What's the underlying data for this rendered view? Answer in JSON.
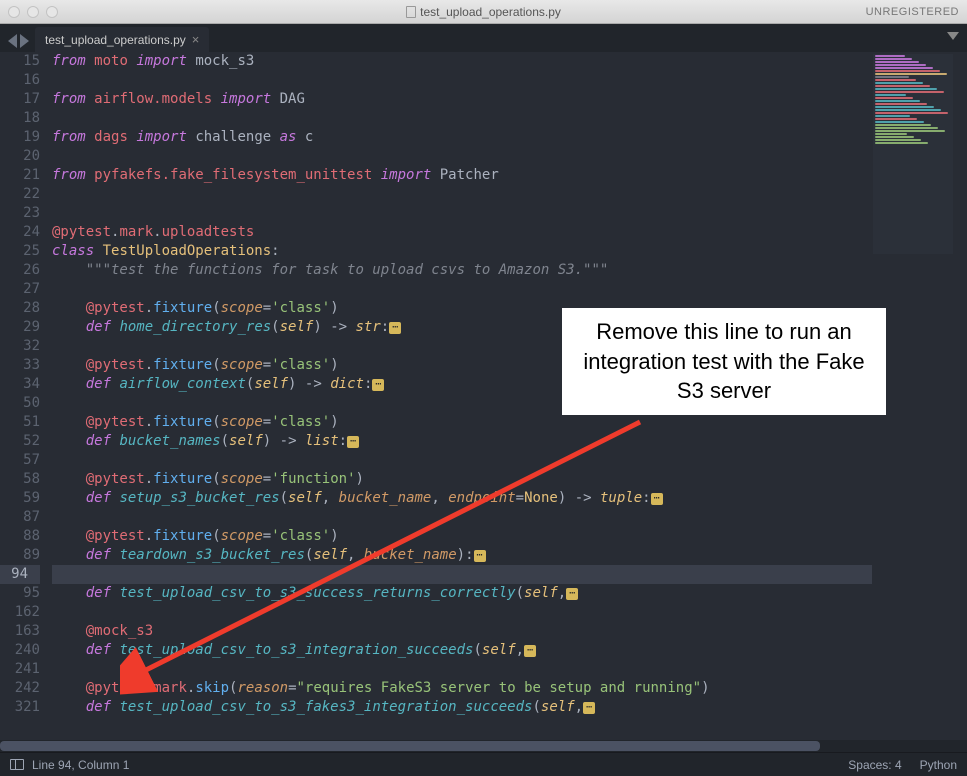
{
  "titlebar": {
    "filename": "test_upload_operations.py",
    "registration": "UNREGISTERED"
  },
  "tab": {
    "name": "test_upload_operations.py",
    "close": "×"
  },
  "annotation": "Remove this line to run an integration test with the Fake S3 server",
  "statusbar": {
    "position": "Line 94, Column 1",
    "spaces": "Spaces: 4",
    "syntax": "Python"
  },
  "gutter_lines": [
    "15",
    "16",
    "17",
    "18",
    "19",
    "20",
    "21",
    "22",
    "23",
    "24",
    "25",
    "26",
    "27",
    "28",
    "29",
    "32",
    "33",
    "34",
    "50",
    "51",
    "52",
    "57",
    "58",
    "59",
    "87",
    "88",
    "89",
    "94",
    "95",
    "162",
    "163",
    "240",
    "241",
    "242",
    "321"
  ],
  "code_lines": [
    {
      "html": "<span class='kw'>from</span> <span class='pink'>moto</span> <span class='kw'>import</span> mock_s3"
    },
    {
      "html": ""
    },
    {
      "html": "<span class='kw'>from</span> <span class='pink'>airflow.models</span> <span class='kw'>import</span> DAG"
    },
    {
      "html": ""
    },
    {
      "html": "<span class='kw'>from</span> <span class='pink'>dags</span> <span class='kw'>import</span> challenge <span class='kw'>as</span> c"
    },
    {
      "html": ""
    },
    {
      "html": "<span class='kw'>from</span> <span class='pink'>pyfakefs.fake_filesystem_unittest</span> <span class='kw'>import</span> Patcher"
    },
    {
      "html": ""
    },
    {
      "html": ""
    },
    {
      "html": "<span class='pink'>@pytest</span><span class='pn'>.</span><span class='pink'>mark</span><span class='pn'>.</span><span class='pink'>uploadtests</span>"
    },
    {
      "html": "<span class='kw2'>class</span> <span class='cls'>TestUploadOperations</span><span class='pn'>:</span>"
    },
    {
      "html": "    <span class='cm'>\"\"\"test the functions for task to upload csvs to Amazon S3.\"\"\"</span>"
    },
    {
      "html": ""
    },
    {
      "html": "    <span class='pink'>@pytest</span><span class='pn'>.</span><span class='fn'>fixture</span><span class='pn'>(</span><span class='arg'>scope</span><span class='op'>=</span><span class='str'>'class'</span><span class='pn'>)</span>"
    },
    {
      "html": "    <span class='kw2'>def</span> <span class='fnname'>home_directory_res</span><span class='pn'>(</span><span class='slf'>self</span><span class='pn'>)</span> <span class='op'>-&gt;</span> <span class='tp'>str</span><span class='pn'>:</span><span class='fold'>⋯</span>"
    },
    {
      "html": ""
    },
    {
      "html": "    <span class='pink'>@pytest</span><span class='pn'>.</span><span class='fn'>fixture</span><span class='pn'>(</span><span class='arg'>scope</span><span class='op'>=</span><span class='str'>'class'</span><span class='pn'>)</span>"
    },
    {
      "html": "    <span class='kw2'>def</span> <span class='fnname'>airflow_context</span><span class='pn'>(</span><span class='slf'>self</span><span class='pn'>)</span> <span class='op'>-&gt;</span> <span class='tp'>dict</span><span class='pn'>:</span><span class='fold'>⋯</span>"
    },
    {
      "html": ""
    },
    {
      "html": "    <span class='pink'>@pytest</span><span class='pn'>.</span><span class='fn'>fixture</span><span class='pn'>(</span><span class='arg'>scope</span><span class='op'>=</span><span class='str'>'class'</span><span class='pn'>)</span>"
    },
    {
      "html": "    <span class='kw2'>def</span> <span class='fnname'>bucket_names</span><span class='pn'>(</span><span class='slf'>self</span><span class='pn'>)</span> <span class='op'>-&gt;</span> <span class='tp'>list</span><span class='pn'>:</span><span class='fold'>⋯</span>"
    },
    {
      "html": ""
    },
    {
      "html": "    <span class='pink'>@pytest</span><span class='pn'>.</span><span class='fn'>fixture</span><span class='pn'>(</span><span class='arg'>scope</span><span class='op'>=</span><span class='str'>'function'</span><span class='pn'>)</span>"
    },
    {
      "html": "    <span class='kw2'>def</span> <span class='fnname'>setup_s3_bucket_res</span><span class='pn'>(</span><span class='slf'>self</span><span class='pn'>,</span> <span class='arg'>bucket_name</span><span class='pn'>,</span> <span class='arg'>endpoint</span><span class='op'>=</span><span class='cls'>None</span><span class='pn'>)</span> <span class='op'>-&gt;</span> <span class='tp'>tuple</span><span class='pn'>:</span><span class='fold'>⋯</span>"
    },
    {
      "html": ""
    },
    {
      "html": "    <span class='pink'>@pytest</span><span class='pn'>.</span><span class='fn'>fixture</span><span class='pn'>(</span><span class='arg'>scope</span><span class='op'>=</span><span class='str'>'class'</span><span class='pn'>)</span>"
    },
    {
      "html": "    <span class='kw2'>def</span> <span class='fnname'>teardown_s3_bucket_res</span><span class='pn'>(</span><span class='slf'>self</span><span class='pn'>,</span> <span class='arg'>bucket_name</span><span class='pn'>):</span><span class='fold'>⋯</span>"
    },
    {
      "html": "",
      "current": true
    },
    {
      "html": "    <span class='kw2'>def</span> <span class='fnname'>test_upload_csv_to_s3_success_returns_correctly</span><span class='pn'>(</span><span class='slf'>self</span><span class='pn'>,</span><span class='fold'>⋯</span>"
    },
    {
      "html": ""
    },
    {
      "html": "    <span class='pink'>@mock_s3</span>"
    },
    {
      "html": "    <span class='kw2'>def</span> <span class='fnname'>test_upload_csv_to_s3_integration_succeeds</span><span class='pn'>(</span><span class='slf'>self</span><span class='pn'>,</span><span class='fold'>⋯</span>"
    },
    {
      "html": ""
    },
    {
      "html": "    <span class='pink'>@pytest</span><span class='pn'>.</span><span class='pink'>mark</span><span class='pn'>.</span><span class='fn'>skip</span><span class='pn'>(</span><span class='arg'>reason</span><span class='op'>=</span><span class='str'>\"requires FakeS3 server to be setup and running\"</span><span class='pn'>)</span>"
    },
    {
      "html": "    <span class='kw2'>def</span> <span class='fnname'>test_upload_csv_to_s3_fakes3_integration_succeeds</span><span class='pn'>(</span><span class='slf'>self</span><span class='pn'>,</span><span class='fold'>⋯</span>"
    },
    {
      "html": ""
    }
  ],
  "minimap_colors": [
    "#c678dd",
    "#c678dd",
    "#c678dd",
    "#c678dd",
    "#c678dd",
    "#e06c75",
    "#e5c07b",
    "#7f848e",
    "#e06c75",
    "#56b6c2",
    "#e06c75",
    "#56b6c2",
    "#e06c75",
    "#56b6c2",
    "#e06c75",
    "#56b6c2",
    "#e06c75",
    "#56b6c2",
    "#56b6c2",
    "#e06c75",
    "#56b6c2",
    "#e06c75",
    "#56b6c2",
    "#98c379",
    "#98c379",
    "#98c379",
    "#98c379",
    "#98c379",
    "#98c379",
    "#98c379"
  ]
}
